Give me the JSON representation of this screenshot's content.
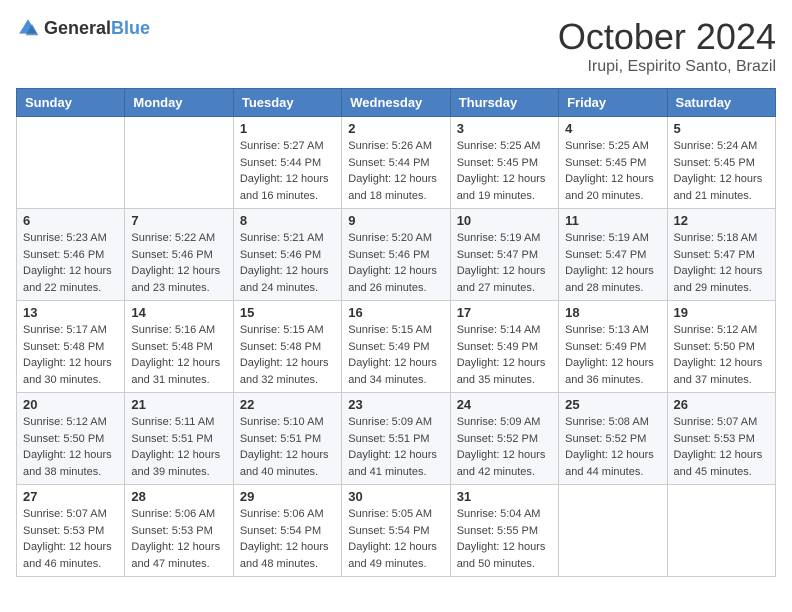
{
  "logo": {
    "general": "General",
    "blue": "Blue"
  },
  "title": "October 2024",
  "location": "Irupi, Espirito Santo, Brazil",
  "weekdays": [
    "Sunday",
    "Monday",
    "Tuesday",
    "Wednesday",
    "Thursday",
    "Friday",
    "Saturday"
  ],
  "weeks": [
    [
      {
        "day": "",
        "sunrise": "",
        "sunset": "",
        "daylight": ""
      },
      {
        "day": "",
        "sunrise": "",
        "sunset": "",
        "daylight": ""
      },
      {
        "day": "1",
        "sunrise": "Sunrise: 5:27 AM",
        "sunset": "Sunset: 5:44 PM",
        "daylight": "Daylight: 12 hours and 16 minutes."
      },
      {
        "day": "2",
        "sunrise": "Sunrise: 5:26 AM",
        "sunset": "Sunset: 5:44 PM",
        "daylight": "Daylight: 12 hours and 18 minutes."
      },
      {
        "day": "3",
        "sunrise": "Sunrise: 5:25 AM",
        "sunset": "Sunset: 5:45 PM",
        "daylight": "Daylight: 12 hours and 19 minutes."
      },
      {
        "day": "4",
        "sunrise": "Sunrise: 5:25 AM",
        "sunset": "Sunset: 5:45 PM",
        "daylight": "Daylight: 12 hours and 20 minutes."
      },
      {
        "day": "5",
        "sunrise": "Sunrise: 5:24 AM",
        "sunset": "Sunset: 5:45 PM",
        "daylight": "Daylight: 12 hours and 21 minutes."
      }
    ],
    [
      {
        "day": "6",
        "sunrise": "Sunrise: 5:23 AM",
        "sunset": "Sunset: 5:46 PM",
        "daylight": "Daylight: 12 hours and 22 minutes."
      },
      {
        "day": "7",
        "sunrise": "Sunrise: 5:22 AM",
        "sunset": "Sunset: 5:46 PM",
        "daylight": "Daylight: 12 hours and 23 minutes."
      },
      {
        "day": "8",
        "sunrise": "Sunrise: 5:21 AM",
        "sunset": "Sunset: 5:46 PM",
        "daylight": "Daylight: 12 hours and 24 minutes."
      },
      {
        "day": "9",
        "sunrise": "Sunrise: 5:20 AM",
        "sunset": "Sunset: 5:46 PM",
        "daylight": "Daylight: 12 hours and 26 minutes."
      },
      {
        "day": "10",
        "sunrise": "Sunrise: 5:19 AM",
        "sunset": "Sunset: 5:47 PM",
        "daylight": "Daylight: 12 hours and 27 minutes."
      },
      {
        "day": "11",
        "sunrise": "Sunrise: 5:19 AM",
        "sunset": "Sunset: 5:47 PM",
        "daylight": "Daylight: 12 hours and 28 minutes."
      },
      {
        "day": "12",
        "sunrise": "Sunrise: 5:18 AM",
        "sunset": "Sunset: 5:47 PM",
        "daylight": "Daylight: 12 hours and 29 minutes."
      }
    ],
    [
      {
        "day": "13",
        "sunrise": "Sunrise: 5:17 AM",
        "sunset": "Sunset: 5:48 PM",
        "daylight": "Daylight: 12 hours and 30 minutes."
      },
      {
        "day": "14",
        "sunrise": "Sunrise: 5:16 AM",
        "sunset": "Sunset: 5:48 PM",
        "daylight": "Daylight: 12 hours and 31 minutes."
      },
      {
        "day": "15",
        "sunrise": "Sunrise: 5:15 AM",
        "sunset": "Sunset: 5:48 PM",
        "daylight": "Daylight: 12 hours and 32 minutes."
      },
      {
        "day": "16",
        "sunrise": "Sunrise: 5:15 AM",
        "sunset": "Sunset: 5:49 PM",
        "daylight": "Daylight: 12 hours and 34 minutes."
      },
      {
        "day": "17",
        "sunrise": "Sunrise: 5:14 AM",
        "sunset": "Sunset: 5:49 PM",
        "daylight": "Daylight: 12 hours and 35 minutes."
      },
      {
        "day": "18",
        "sunrise": "Sunrise: 5:13 AM",
        "sunset": "Sunset: 5:49 PM",
        "daylight": "Daylight: 12 hours and 36 minutes."
      },
      {
        "day": "19",
        "sunrise": "Sunrise: 5:12 AM",
        "sunset": "Sunset: 5:50 PM",
        "daylight": "Daylight: 12 hours and 37 minutes."
      }
    ],
    [
      {
        "day": "20",
        "sunrise": "Sunrise: 5:12 AM",
        "sunset": "Sunset: 5:50 PM",
        "daylight": "Daylight: 12 hours and 38 minutes."
      },
      {
        "day": "21",
        "sunrise": "Sunrise: 5:11 AM",
        "sunset": "Sunset: 5:51 PM",
        "daylight": "Daylight: 12 hours and 39 minutes."
      },
      {
        "day": "22",
        "sunrise": "Sunrise: 5:10 AM",
        "sunset": "Sunset: 5:51 PM",
        "daylight": "Daylight: 12 hours and 40 minutes."
      },
      {
        "day": "23",
        "sunrise": "Sunrise: 5:09 AM",
        "sunset": "Sunset: 5:51 PM",
        "daylight": "Daylight: 12 hours and 41 minutes."
      },
      {
        "day": "24",
        "sunrise": "Sunrise: 5:09 AM",
        "sunset": "Sunset: 5:52 PM",
        "daylight": "Daylight: 12 hours and 42 minutes."
      },
      {
        "day": "25",
        "sunrise": "Sunrise: 5:08 AM",
        "sunset": "Sunset: 5:52 PM",
        "daylight": "Daylight: 12 hours and 44 minutes."
      },
      {
        "day": "26",
        "sunrise": "Sunrise: 5:07 AM",
        "sunset": "Sunset: 5:53 PM",
        "daylight": "Daylight: 12 hours and 45 minutes."
      }
    ],
    [
      {
        "day": "27",
        "sunrise": "Sunrise: 5:07 AM",
        "sunset": "Sunset: 5:53 PM",
        "daylight": "Daylight: 12 hours and 46 minutes."
      },
      {
        "day": "28",
        "sunrise": "Sunrise: 5:06 AM",
        "sunset": "Sunset: 5:53 PM",
        "daylight": "Daylight: 12 hours and 47 minutes."
      },
      {
        "day": "29",
        "sunrise": "Sunrise: 5:06 AM",
        "sunset": "Sunset: 5:54 PM",
        "daylight": "Daylight: 12 hours and 48 minutes."
      },
      {
        "day": "30",
        "sunrise": "Sunrise: 5:05 AM",
        "sunset": "Sunset: 5:54 PM",
        "daylight": "Daylight: 12 hours and 49 minutes."
      },
      {
        "day": "31",
        "sunrise": "Sunrise: 5:04 AM",
        "sunset": "Sunset: 5:55 PM",
        "daylight": "Daylight: 12 hours and 50 minutes."
      },
      {
        "day": "",
        "sunrise": "",
        "sunset": "",
        "daylight": ""
      },
      {
        "day": "",
        "sunrise": "",
        "sunset": "",
        "daylight": ""
      }
    ]
  ]
}
